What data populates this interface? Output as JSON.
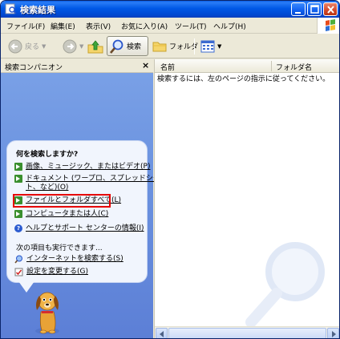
{
  "window": {
    "title": "検索結果",
    "colors": {
      "titlebar": "#0058e6",
      "taskpane": "#6c93e0",
      "highlight": "#e60000"
    }
  },
  "menubar": {
    "items": [
      "ファイル(F)",
      "編集(E)",
      "表示(V)",
      "お気に入り(A)",
      "ツール(T)",
      "ヘルプ(H)"
    ]
  },
  "toolbar": {
    "back": "戻る",
    "search": "検索",
    "folders": "フォルダ"
  },
  "companion": {
    "header": "検索コンパニオン",
    "close": "×",
    "question": "何を検索しますか?",
    "options": [
      "画像、ミュージック、またはビデオ(P)",
      "ドキュメント (ワープロ、スプレッドシー",
      "ト、など)(O)",
      "ファイルとフォルダすべて(L)",
      "コンピュータまたは人(C)",
      "ヘルプとサポート センターの情報(I)"
    ],
    "also": "次の項目も実行できます...",
    "tasks": [
      "インターネットを検索する(S)",
      "設定を変更する(G)"
    ]
  },
  "results": {
    "columns": {
      "name": "名前",
      "folder": "フォルダ名"
    },
    "message": "検索するには、左のページの指示に従ってください。"
  }
}
